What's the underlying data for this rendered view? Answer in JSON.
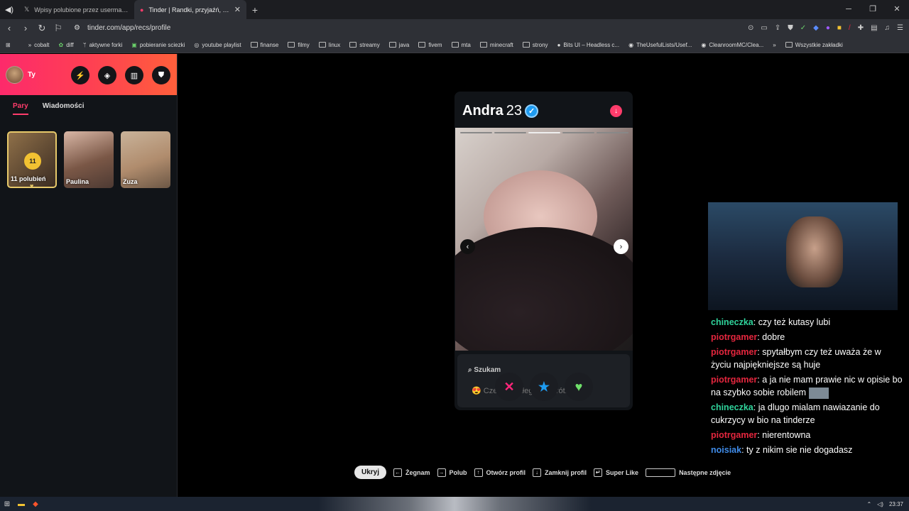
{
  "browser": {
    "tabs": [
      {
        "title": "Wpisy polubione przez usermacieg (",
        "icon": "x-icon",
        "active": false
      },
      {
        "title": "Tinder | Randki, przyjaźń, nowe z",
        "icon": "tinder-flame-icon",
        "active": true
      }
    ],
    "url": "tinder.com/app/recs/profile",
    "bookmarks": [
      "cobalt",
      "diff",
      "aktywne forki",
      "pobieranie sciezki",
      "youtube playlist",
      "finanse",
      "filmy",
      "linux",
      "streamy",
      "java",
      "fivem",
      "mta",
      "minecraft",
      "strony",
      "Bits UI – Headless c...",
      "TheUsefulLists/Usef...",
      "CleanroomMC/Clea..."
    ],
    "all_bookmarks": "Wszystkie zakładki"
  },
  "sidebar": {
    "user_label": "Ty",
    "tabs": {
      "pary": "Pary",
      "wiadomosci": "Wiadomości"
    },
    "likes_count": "11",
    "likes_label": "11 polubień",
    "matches": [
      {
        "name": "Paulina"
      },
      {
        "name": "Zuza"
      }
    ]
  },
  "profile": {
    "name": "Andra",
    "age": "23",
    "looking_label": "Szukam",
    "looking_text": "Czegoś stałego lub krótko",
    "photo_count": 5,
    "photo_index": 3
  },
  "hints": {
    "hide": "Ukryj",
    "nope": "Żegnam",
    "like": "Polub",
    "open": "Otwórz profil",
    "close": "Zamknij profil",
    "superlike": "Super Like",
    "next": "Następne zdjęcie"
  },
  "chat": [
    {
      "user": "chineczka",
      "cls": "u1",
      "text": ": czy też kutasy lubi"
    },
    {
      "user": "piotrgamer",
      "cls": "u2",
      "text": ": dobre"
    },
    {
      "user": "piotrgamer",
      "cls": "u2",
      "text": ": spytałbym czy też uważa że w życiu najpiękniejsze są huje"
    },
    {
      "user": "piotrgamer",
      "cls": "u2",
      "text": ": a ja nie mam prawie nic w opisie bo na szybko sobie robilem"
    },
    {
      "user": "chineczka",
      "cls": "u1",
      "text": ": ja dlugo mialam nawiazanie do cukrzycy w bio na tinderze"
    },
    {
      "user": "piotrgamer",
      "cls": "u2",
      "text": ": nierentowna"
    },
    {
      "user": "noisiak",
      "cls": "u3",
      "text": ": ty z nikim sie nie dogadasz"
    }
  ],
  "taskbar": {
    "time": "23:37"
  }
}
